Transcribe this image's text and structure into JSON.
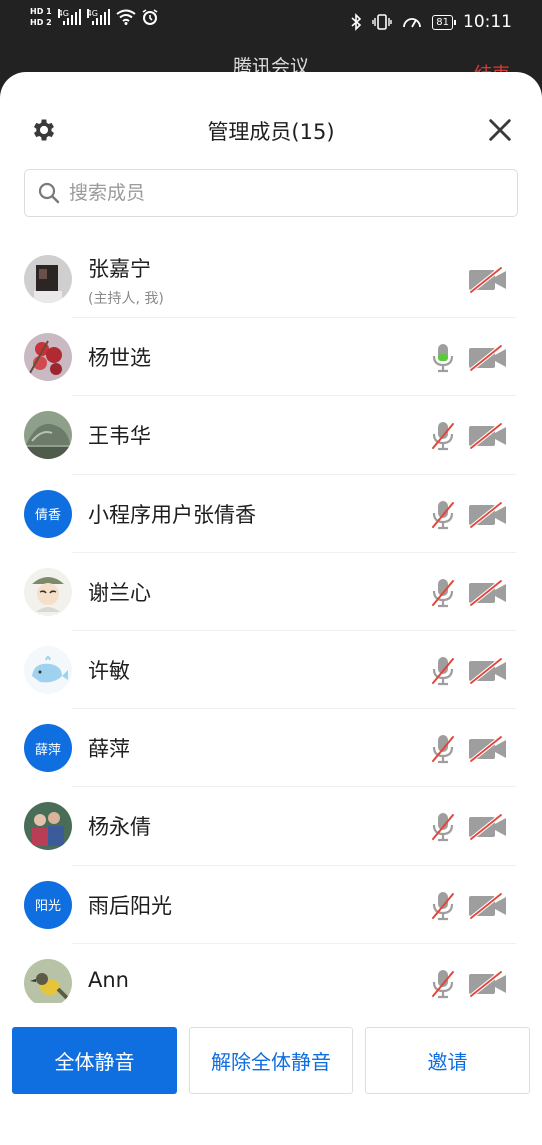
{
  "status_bar": {
    "hd_top": "HD 1",
    "hd_bottom": "HD 2",
    "net1": "4G",
    "net2": "4G",
    "battery": "81",
    "time": "10:11"
  },
  "background_app": {
    "title": "腾讯会议",
    "end_label": "结束"
  },
  "sheet": {
    "title": "管理成员(15)",
    "search_placeholder": "搜索成员"
  },
  "members": [
    {
      "name": "张嘉宁",
      "sub": "(主持人, 我)",
      "avatar": "photo-dark",
      "mic": "none",
      "cam": "off"
    },
    {
      "name": "杨世选",
      "sub": "",
      "avatar": "photo-berries",
      "mic": "active",
      "cam": "off"
    },
    {
      "name": "王韦华",
      "sub": "",
      "avatar": "photo-rock",
      "mic": "muted",
      "cam": "off"
    },
    {
      "name": "小程序用户张倩香",
      "sub": "",
      "avatar_text": "倩香",
      "mic": "muted",
      "cam": "off"
    },
    {
      "name": "谢兰心",
      "sub": "",
      "avatar": "photo-cartoon",
      "mic": "muted",
      "cam": "off"
    },
    {
      "name": "许敏",
      "sub": "",
      "avatar": "photo-whale",
      "mic": "muted",
      "cam": "off"
    },
    {
      "name": "薛萍",
      "sub": "",
      "avatar_text": "薛萍",
      "mic": "muted",
      "cam": "off"
    },
    {
      "name": "杨永倩",
      "sub": "",
      "avatar": "photo-group",
      "mic": "muted",
      "cam": "off"
    },
    {
      "name": "雨后阳光",
      "sub": "",
      "avatar_text": "阳光",
      "mic": "muted",
      "cam": "off"
    },
    {
      "name": "Ann",
      "sub": "",
      "avatar": "photo-bird",
      "mic": "muted",
      "cam": "off"
    }
  ],
  "footer": {
    "mute_all": "全体静音",
    "unmute_all": "解除全体静音",
    "invite": "邀请"
  },
  "colors": {
    "accent": "#0f6ee0",
    "mic_active": "#5cc93b",
    "muted_slash": "#e2463b",
    "icon_gray": "#9e9e9e"
  },
  "icons": {
    "settings": "gear-icon",
    "close": "close-icon",
    "search": "search-icon",
    "mic": "microphone-icon",
    "camera": "camera-off-icon"
  }
}
